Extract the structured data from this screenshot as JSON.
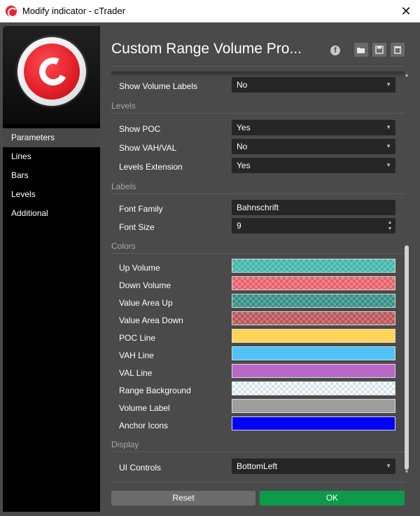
{
  "window": {
    "title": "Modify indicator - cTrader",
    "close_glyph": "✕"
  },
  "sidebar": {
    "items": [
      {
        "label": "Parameters",
        "active": true
      },
      {
        "label": "Lines",
        "active": false
      },
      {
        "label": "Bars",
        "active": false
      },
      {
        "label": "Levels",
        "active": false
      },
      {
        "label": "Additional",
        "active": false
      }
    ]
  },
  "header": {
    "title": "Custom Range Volume Pro...",
    "fb_glyph": "f",
    "icons": [
      "open-folder-icon",
      "save-icon",
      "trash-icon"
    ]
  },
  "params": {
    "show_volume_labels": {
      "label": "Show Volume Labels",
      "value": "No"
    },
    "levels_section": "Levels",
    "show_poc": {
      "label": "Show POC",
      "value": "Yes"
    },
    "show_vah_val": {
      "label": "Show VAH/VAL",
      "value": "No"
    },
    "levels_extension": {
      "label": "Levels Extension",
      "value": "Yes"
    },
    "labels_section": "Labels",
    "font_family": {
      "label": "Font Family",
      "value": "Bahnschrift"
    },
    "font_size": {
      "label": "Font Size",
      "value": "9"
    },
    "colors_section": "Colors",
    "colors": [
      {
        "label": "Up Volume",
        "color": "#3fb6a8",
        "checker": true
      },
      {
        "label": "Down Volume",
        "color": "#e8606a",
        "checker": true
      },
      {
        "label": "Value Area Up",
        "color": "#318f84",
        "checker": true
      },
      {
        "label": "Value Area Down",
        "color": "#b95457",
        "checker": true
      },
      {
        "label": "POC Line",
        "color": "#ffd457",
        "checker": false
      },
      {
        "label": "VAH Line",
        "color": "#4fc3f7",
        "checker": false
      },
      {
        "label": "VAL Line",
        "color": "#ba68c8",
        "checker": false
      },
      {
        "label": "Range Background",
        "color": "#ffffff",
        "checker": "light"
      },
      {
        "label": "Volume Label",
        "color": "#9e9e9e",
        "checker": false
      },
      {
        "label": "Anchor Icons",
        "color": "#0000ff",
        "checker": false
      }
    ],
    "display_section": "Display",
    "ui_controls": {
      "label": "UI Controls",
      "value": "BottomLeft"
    }
  },
  "buttons": {
    "reset": "Reset",
    "ok": "OK"
  },
  "caret": "▼"
}
